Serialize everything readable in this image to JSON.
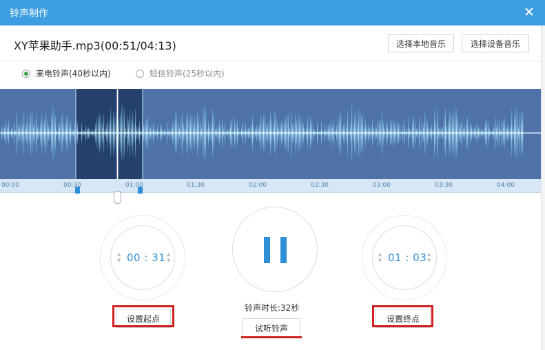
{
  "window": {
    "title": "铃声制作"
  },
  "file": {
    "title": "XY苹果助手.mp3(00:51/04:13)"
  },
  "buttons": {
    "local_music": "选择本地音乐",
    "device_music": "选择设备音乐"
  },
  "ringtypes": [
    {
      "label": "来电铃声(40秒以内)",
      "selected": true
    },
    {
      "label": "短信铃声(25秒以内)",
      "selected": false
    }
  ],
  "timeline": {
    "ticks": [
      "00:00",
      "00:30",
      "01:00",
      "01:30",
      "02:00",
      "02:30",
      "03:00",
      "03:30",
      "04:00"
    ]
  },
  "start": {
    "time": "00 : 31",
    "button": "设置起点"
  },
  "end": {
    "time": "01 : 03",
    "button": "设置终点"
  },
  "player": {
    "duration_label": "铃声时长:32秒",
    "preview_button": "试听铃声",
    "state": "pause-icon"
  },
  "colors": {
    "titlebar": "#3d9ee2",
    "accent": "#2f8ed6",
    "wave_bg": "#4f73a8",
    "highlight": "#d22020"
  }
}
